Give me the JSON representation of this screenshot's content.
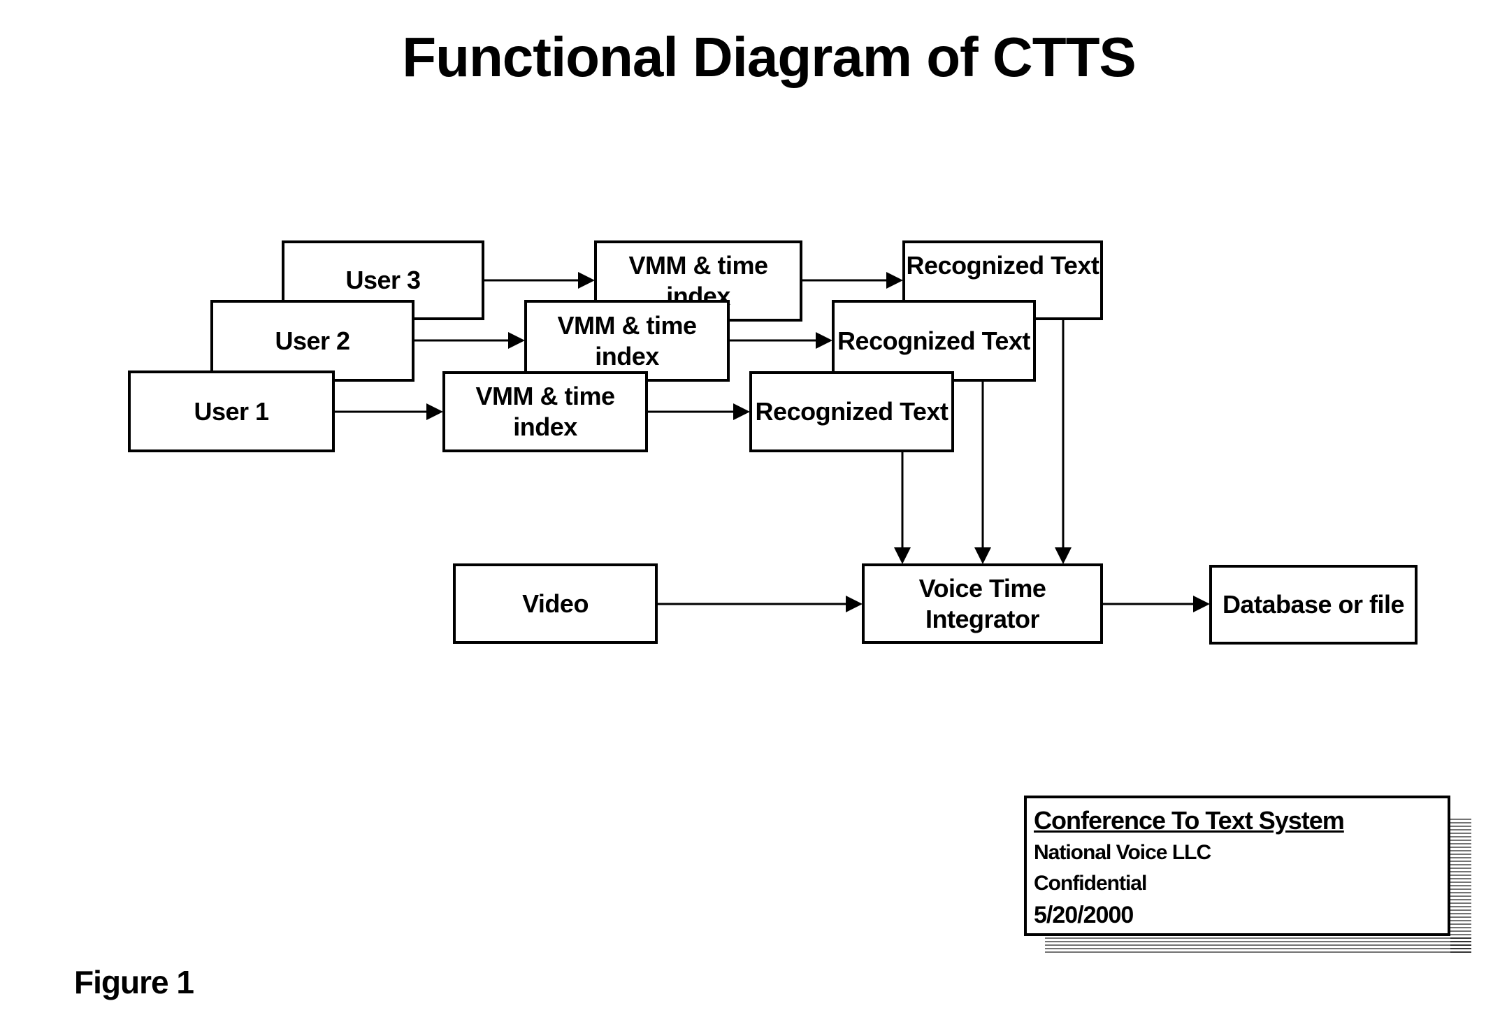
{
  "title": "Functional Diagram of CTTS",
  "nodes": {
    "user3": "User 3",
    "user2": "User 2",
    "user1": "User 1",
    "vmm3": "VMM & time index",
    "vmm2": "VMM & time index",
    "vmm1": "VMM & time index",
    "rec3": "Recognized Text",
    "rec2": "Recognized Text",
    "rec1": "Recognized Text",
    "video": "Video",
    "integrator": "Voice Time Integrator",
    "database": "Database or file"
  },
  "edges": [
    {
      "from": "User 3",
      "to": "VMM & time index (3)"
    },
    {
      "from": "User 2",
      "to": "VMM & time index (2)"
    },
    {
      "from": "User 1",
      "to": "VMM & time index (1)"
    },
    {
      "from": "VMM & time index (3)",
      "to": "Recognized Text (3)"
    },
    {
      "from": "VMM & time index (2)",
      "to": "Recognized Text (2)"
    },
    {
      "from": "VMM & time index (1)",
      "to": "Recognized Text (1)"
    },
    {
      "from": "Recognized Text (1)",
      "to": "Voice Time Integrator"
    },
    {
      "from": "Recognized Text (2)",
      "to": "Voice Time Integrator"
    },
    {
      "from": "Recognized Text (3)",
      "to": "Voice Time Integrator"
    },
    {
      "from": "Video",
      "to": "Voice Time Integrator"
    },
    {
      "from": "Voice Time Integrator",
      "to": "Database or file"
    }
  ],
  "legend": {
    "system_name": "Conference To Text System",
    "company": "National Voice LLC",
    "classification": "Confidential",
    "date": "5/20/2000"
  },
  "figure_label": "Figure 1"
}
